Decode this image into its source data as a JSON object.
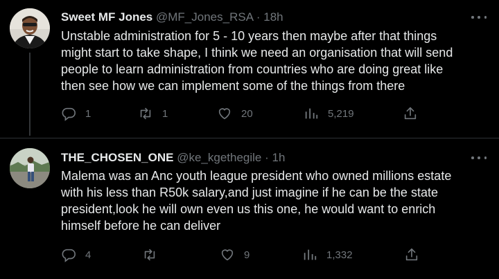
{
  "colors": {
    "background": "#000000",
    "text": "#e7e9ea",
    "muted": "#71767b",
    "divider": "#2f3336"
  },
  "tweets": [
    {
      "display_name": "Sweet MF Jones",
      "handle": "@MF_Jones_RSA",
      "separator": "·",
      "time": "18h",
      "lines": [
        "Unstable administration for 5 - 10 years then maybe after that things",
        "might start to take shape, I think we need an organisation that will send",
        "people to learn administration from countries who are doing great like",
        "then see how we can implement some of the things from there"
      ],
      "replies": "1",
      "retweets": "1",
      "likes": "20",
      "views": "5,219",
      "icons": {
        "reply": "reply-icon",
        "retweet": "retweet-icon",
        "like": "heart-icon",
        "views": "views-icon",
        "share": "share-icon",
        "more": "more-icon"
      }
    },
    {
      "display_name": "THE_CHOSEN_ONE",
      "handle": "@ke_kgethegile",
      "separator": "·",
      "time": "1h",
      "lines": [
        "Malema was an Anc youth league president who owned millions estate",
        "with his less than R50k salary,and just imagine if he can be the state",
        "president,look he will own even us this one, he would want to enrich",
        "himself before he can deliver"
      ],
      "replies": "4",
      "retweets": "",
      "likes": "9",
      "views": "1,332",
      "icons": {
        "reply": "reply-icon",
        "retweet": "retweet-icon",
        "like": "heart-icon",
        "views": "views-icon",
        "share": "share-icon",
        "more": "more-icon"
      }
    }
  ]
}
